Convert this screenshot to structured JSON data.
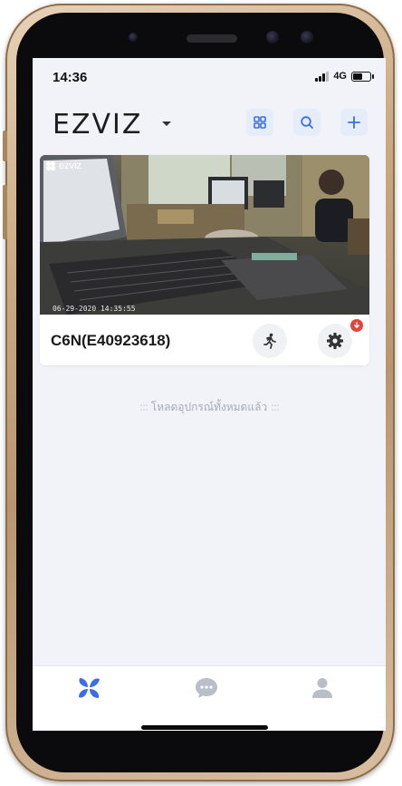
{
  "status_bar": {
    "time": "14:36",
    "network": "4G",
    "signal_bars": 3,
    "battery_level": 0.6
  },
  "app_bar": {
    "logo": "EZVIZ",
    "buttons": [
      {
        "icon": "grid-view-icon"
      },
      {
        "icon": "search-icon"
      },
      {
        "icon": "add-icon"
      }
    ]
  },
  "device_card": {
    "name": "C6N(E40923618)",
    "preview_watermark": "ezviz",
    "preview_timestamp": "06-29-2020 14:35:55",
    "actions": [
      {
        "icon": "motion-detect-icon"
      },
      {
        "icon": "settings-gear-icon",
        "badge": "update-available"
      }
    ]
  },
  "list_footer": {
    "text": "โหลดอุปกรณ์ทั้งหมดแล้ว",
    "deco_left": ":::",
    "deco_right": ":::"
  },
  "tab_bar": {
    "tabs": [
      {
        "icon": "ezviz-home-icon",
        "active": true
      },
      {
        "icon": "message-bubble-icon",
        "active": false
      },
      {
        "icon": "user-profile-icon",
        "active": false
      }
    ]
  },
  "colors": {
    "accent": "#3c6ee8",
    "screen_bg": "#f1f3f9",
    "badge_red": "#e8423c",
    "inactive_icon": "#b9bec9"
  }
}
